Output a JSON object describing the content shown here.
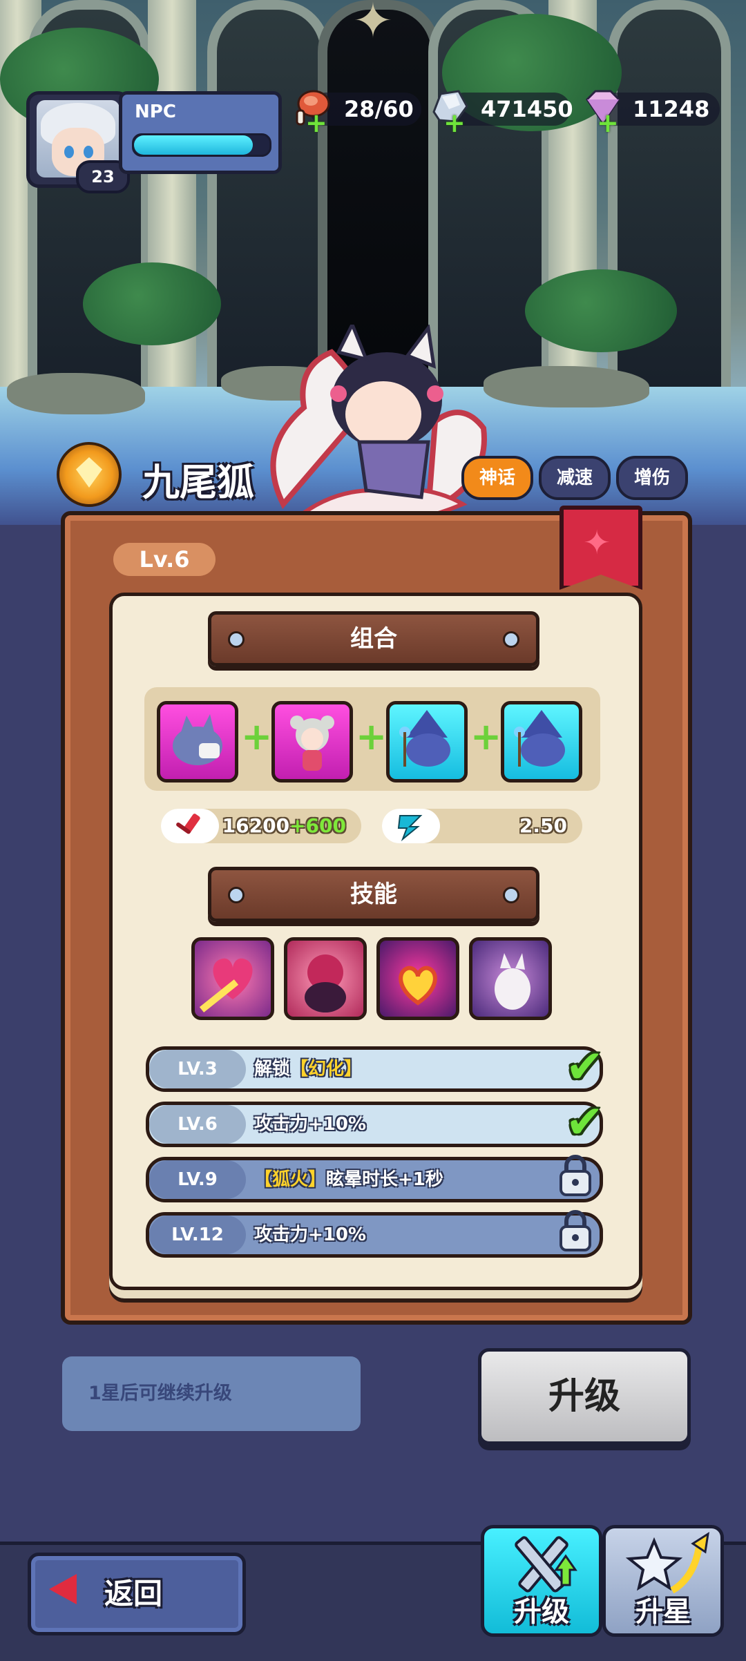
{
  "player": {
    "name": "NPC",
    "level": "23",
    "exp_progress": 0.88
  },
  "resources": {
    "stamina": "28/60",
    "silver": "471450",
    "diamonds": "11248"
  },
  "hero": {
    "name": "九尾狐",
    "tags": [
      "神话",
      "减速",
      "增伤"
    ],
    "level_label": "Lv.6"
  },
  "combo": {
    "header": "组合"
  },
  "stats": {
    "attack_base": "16200",
    "attack_bonus": "+600",
    "attack_speed": "2.50"
  },
  "skills": {
    "header": "技能",
    "rows": [
      {
        "lv": "LV.3",
        "prefix": "解锁",
        "highlight": "【幻化】",
        "suffix": "",
        "status": "done"
      },
      {
        "lv": "LV.6",
        "prefix": "攻击力+10%",
        "highlight": "",
        "suffix": "",
        "status": "done"
      },
      {
        "lv": "LV.9",
        "prefix": "",
        "highlight": "【狐火】",
        "suffix": "眩晕时长+1秒",
        "status": "locked"
      },
      {
        "lv": "LV.12",
        "prefix": "攻击力+10%",
        "highlight": "",
        "suffix": "",
        "status": "locked"
      }
    ]
  },
  "actions": {
    "notice": "1星后可继续升级",
    "upgrade": "升级",
    "back": "返回"
  },
  "nav": {
    "upgrade_tab": "升级",
    "star_tab": "升星"
  },
  "colors": {
    "tag_active": "#f28a1a",
    "tag_inactive": "#3b4270",
    "check": "#6ee43a",
    "bonus_green": "#7ee83a",
    "nav_active": "#19d3e6"
  }
}
